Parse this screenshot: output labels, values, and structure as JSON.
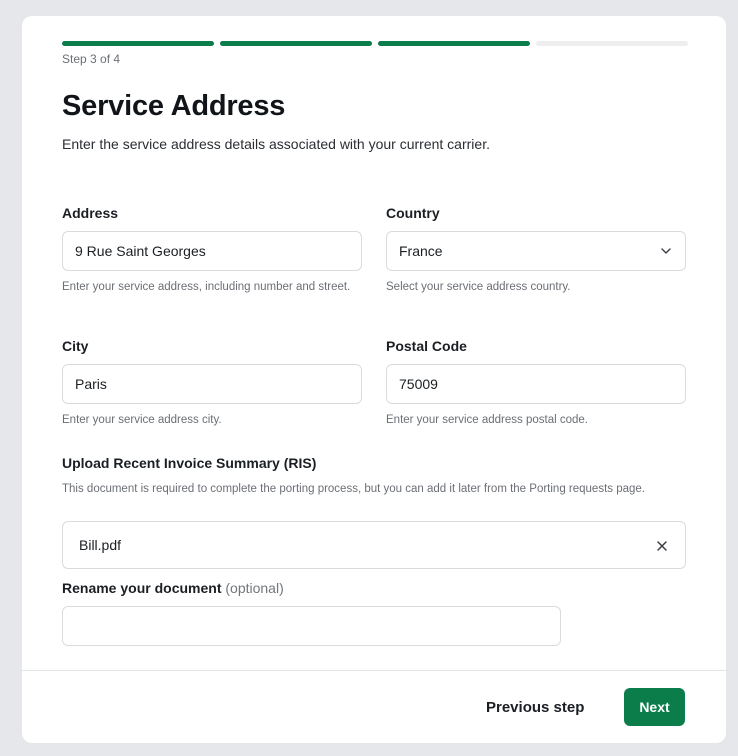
{
  "wizard": {
    "step_label": "Step 3 of 4",
    "steps_total": 4,
    "steps_completed": 3,
    "accent_color": "#0a7d4b"
  },
  "header": {
    "title": "Service Address",
    "subtitle": "Enter the service address details associated with your current carrier."
  },
  "form": {
    "address": {
      "label": "Address",
      "value": "9 Rue Saint Georges",
      "help": "Enter your service address, including number and street."
    },
    "country": {
      "label": "Country",
      "value": "France",
      "help": "Select your service address country."
    },
    "city": {
      "label": "City",
      "value": "Paris",
      "help": "Enter your service address city."
    },
    "postal_code": {
      "label": "Postal Code",
      "value": "75009",
      "help": "Enter your service address postal code."
    },
    "upload": {
      "label": "Upload Recent Invoice Summary (RIS)",
      "help": "This document is required to complete the porting process, but you can add it later from the Porting requests page.",
      "file_name": "Bill.pdf"
    },
    "rename": {
      "label": "Rename your document",
      "optional": "(optional)",
      "value": ""
    }
  },
  "footer": {
    "previous_label": "Previous step",
    "next_label": "Next"
  }
}
